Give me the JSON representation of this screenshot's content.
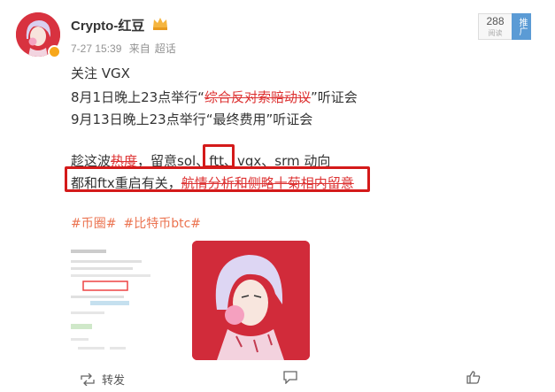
{
  "post": {
    "username": "Crypto-红豆",
    "time": "7-27 15:39",
    "source": "来自",
    "source_name": "超话",
    "read_count": "288",
    "read_label": "阅读",
    "promote_label": "推广",
    "lines": [
      "关注 VGX",
      "8月1日晚上23点举行“",
      "综合反对索赔动议",
      "”听证会",
      "9月13日晚上23点举行“最终费用”听证会"
    ],
    "line4_pre": "趁这波",
    "line4_strike": "热度",
    "line4_mid": "，留意sol、",
    "line4_ftt": "ftt",
    "line4_post": "、vgx、srm 动向",
    "line5_pre": "都和ftx重启有关，",
    "line5_strike": "航情分析和侧略十菊相内留意",
    "tags": [
      "#币圈#",
      "#比特币btc#"
    ]
  },
  "actions": {
    "repost_label": "转发"
  }
}
